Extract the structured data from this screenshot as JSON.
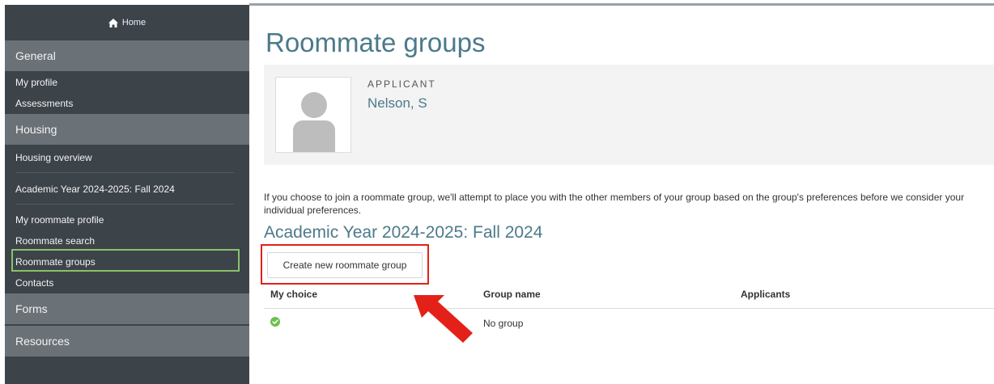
{
  "nav": {
    "home_label": "Home",
    "sections": [
      {
        "title": "General",
        "items": [
          "My profile",
          "Assessments"
        ]
      },
      {
        "title": "Housing",
        "items": [
          "Housing overview",
          "Academic Year 2024-2025: Fall 2024",
          "My roommate profile",
          "Roommate search",
          "Roommate groups",
          "Contacts"
        ]
      },
      {
        "title": "Forms"
      },
      {
        "title": "Resources"
      }
    ],
    "active_item": "Roommate groups"
  },
  "page": {
    "title": "Roommate groups",
    "applicant_label": "APPLICANT",
    "applicant_name": "Nelson, S",
    "info_text": "If you choose to join a roommate group, we'll attempt to place you with the other members of your group based on the group's preferences before we consider your individual preferences.",
    "term_heading": "Academic Year 2024-2025: Fall 2024",
    "create_button_label": "Create new roommate group"
  },
  "table": {
    "headers": [
      "My choice",
      "Group name",
      "Applicants"
    ],
    "rows": [
      {
        "my_choice_icon": "check-circle-icon",
        "group_name": "No group",
        "applicants": ""
      }
    ]
  },
  "colors": {
    "sidebar_bg": "#3c4349",
    "section_header_bg": "#6a7177",
    "active_outline": "#8bc26a",
    "heading_teal": "#4b7a8a",
    "highlight_red": "#e32119",
    "check_green": "#6cc04a"
  }
}
